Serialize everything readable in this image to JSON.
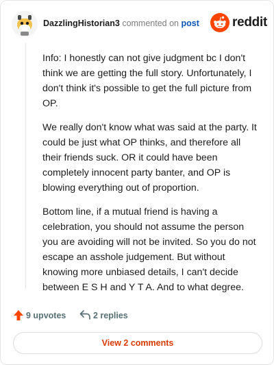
{
  "header": {
    "username": "DazzlingHistorian3",
    "commented_text": "commented on",
    "post_link": "post",
    "brand": "reddit",
    "avatar_icon": "snoo-avatar-icon",
    "brand_icon": "reddit-logo-icon"
  },
  "comment": {
    "paragraphs": [
      "Info: I honestly can not give judgment bc I don't think we are getting the full story. Unfortunately, I don't think it's possible to get the full picture from OP.",
      "We really don't know what was said at the party. It could be just what OP thinks, and therefore all their friends suck. OR it could have been completely innocent party banter, and OP is blowing everything out of proportion.",
      "Bottom line, if a mutual friend is having a celebration, you should not assume the person you are avoiding will not be invited. So you do not escape an asshole judgement. But without knowing more unbiased details, I can't decide between E S H and Y T A. And to what degree."
    ]
  },
  "actions": {
    "upvotes_label": "9 upvotes",
    "replies_label": "2 replies",
    "upvote_icon": "upvote-arrow-icon",
    "reply_icon": "reply-arrow-icon",
    "view_comments_label": "View 2 comments"
  },
  "colors": {
    "brand_orange": "#ff4500",
    "link_blue": "#0a55b8",
    "action_gray": "#576f76",
    "button_text": "#d93a00"
  }
}
